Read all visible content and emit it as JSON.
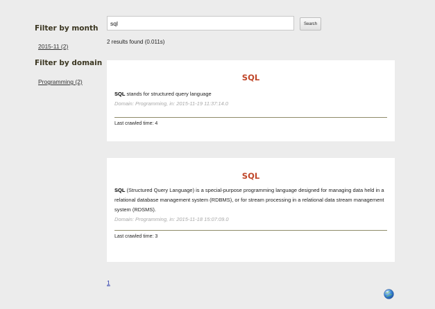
{
  "sidebar": {
    "month_heading": "Filter by month",
    "month_items": [
      {
        "label": "2015-11 (2)"
      }
    ],
    "domain_heading": "Filter by domain",
    "domain_items": [
      {
        "label": "Programming (2)"
      }
    ]
  },
  "search": {
    "value": "sql",
    "button_label": "Search"
  },
  "results": {
    "summary": "2 results found (0.011s)",
    "items": [
      {
        "title": "SQL",
        "desc_bold": "SQL",
        "desc_text": " stands for structured query language",
        "meta": "Domain: Programming, in: 2015-11-19 11:37:14.0",
        "crawl": "Last crawled time: 4"
      },
      {
        "title": "SQL",
        "desc_bold": "SQL",
        "desc_text": " (Structured Query Language) is a special-purpose programming language designed for managing data held in a relational database management system (RDBMS), or for stream processing in a relational data stream management system (RDSMS).",
        "meta": "Domain: Programming, in: 2015-11-18 15:07:09.0",
        "crawl": "Last crawled time: 3"
      }
    ]
  },
  "pagination": {
    "pages": [
      "1"
    ]
  },
  "footer": {
    "icon": "globe-icon"
  }
}
